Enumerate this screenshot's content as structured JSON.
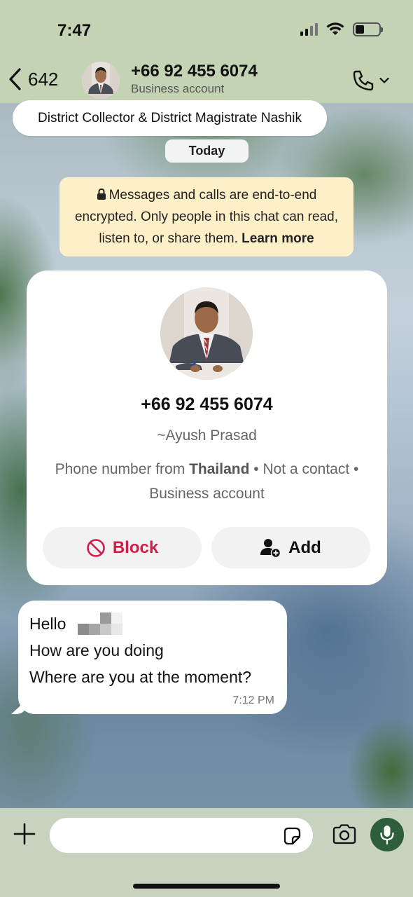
{
  "status_bar": {
    "time": "7:47"
  },
  "header": {
    "back_count": "642",
    "title": "+66 92 455 6074",
    "subtitle": "Business account"
  },
  "business_name": "District Collector & District Magistrate Nashik",
  "date_chip": "Today",
  "encryption": {
    "text": "Messages and calls are end-to-end encrypted. Only people in this chat can read, listen to, or share them.",
    "link": "Learn more"
  },
  "contact_card": {
    "phone": "+66 92 455 6074",
    "name": "~Ayush Prasad",
    "info_prefix": "Phone number from",
    "country": "Thailand",
    "info_suffix": "• Not a contact • Business account",
    "block_label": "Block",
    "add_label": "Add"
  },
  "message": {
    "line1": "Hello",
    "line2": "How are you doing",
    "line3": "Where are you at the moment?",
    "time": "7:12 PM"
  },
  "colors": {
    "header_bg": "#c4d3b4",
    "block_red": "#d21d4a",
    "mic_green": "#2e5d3b",
    "encryption_bg": "#fdf0c8"
  },
  "icons": [
    "back-chevron-icon",
    "phone-icon",
    "chevron-down-icon",
    "lock-icon",
    "block-icon",
    "add-contact-icon",
    "plus-icon",
    "sticker-icon",
    "camera-icon",
    "mic-icon"
  ]
}
